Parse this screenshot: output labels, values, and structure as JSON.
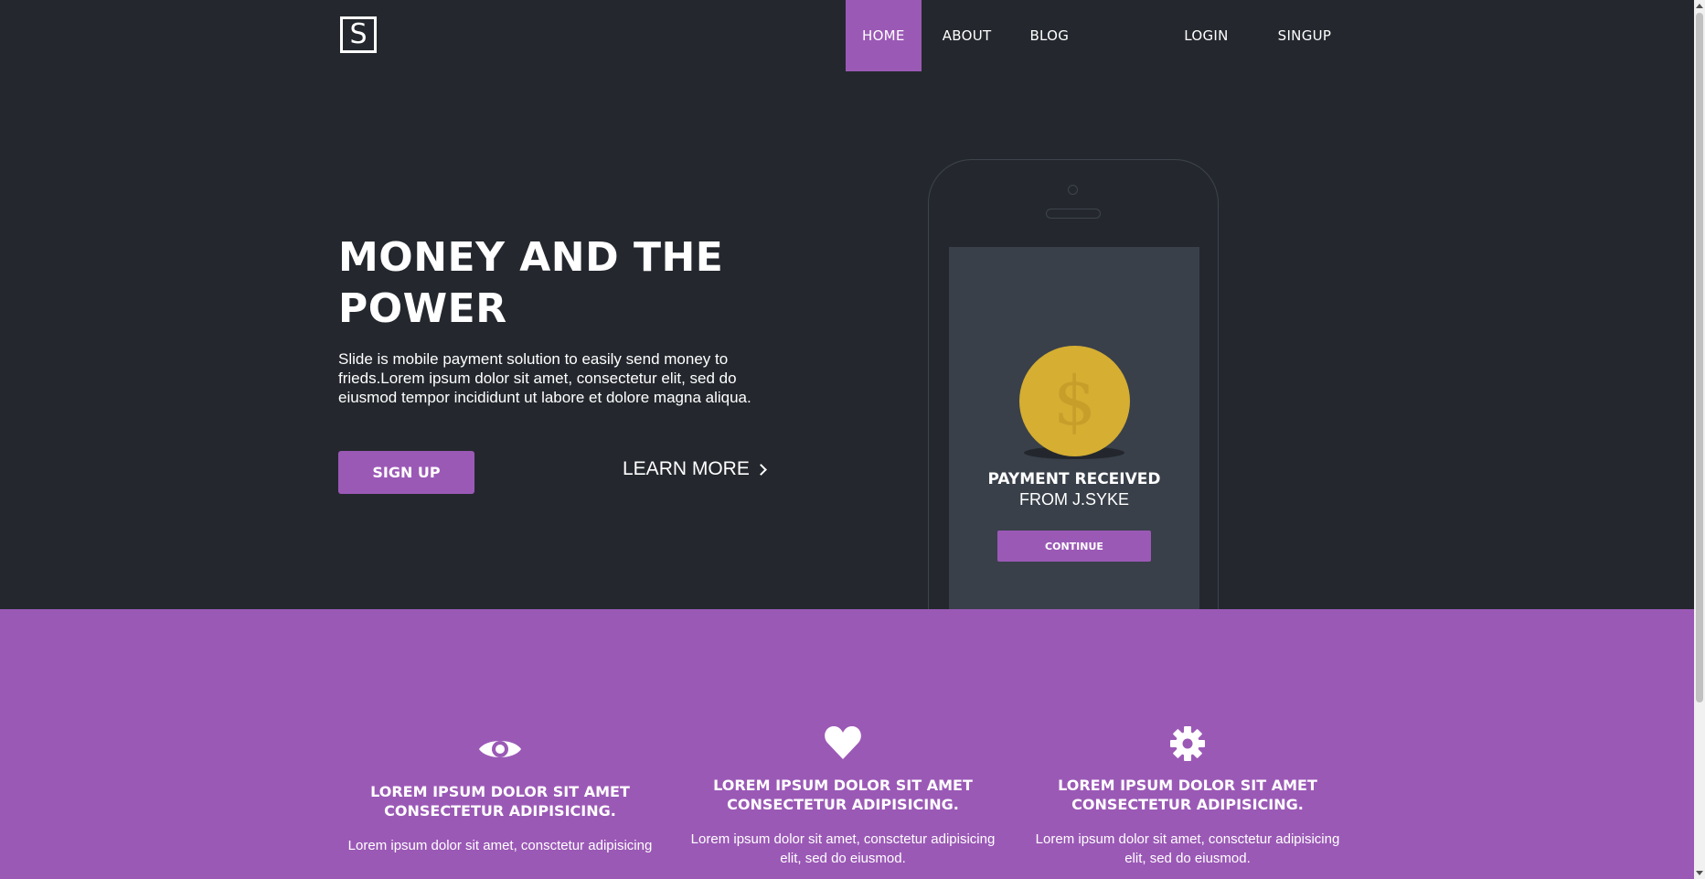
{
  "brand": {
    "logo_letter": "S"
  },
  "nav": {
    "home": "HOME",
    "about": "ABOUT",
    "blog": "BLOG",
    "login": "LOGIN",
    "signup": "SINGUP"
  },
  "hero": {
    "title_line1": "MONEY AND THE",
    "title_line2": "POWER",
    "description": "Slide is mobile payment solution to easily send money to frieds.Lorem ipsum dolor sit amet, consectetur elit, sed do eiusmod tempor incididunt ut labore et dolore magna aliqua.",
    "signup_button": "SIGN UP",
    "learn_more": "LEARN MORE"
  },
  "phone": {
    "coin_symbol": "$",
    "payment_title": "PAYMENT RECEIVED",
    "payment_from": "FROM J.SYKE",
    "continue_button": "CONTINUE"
  },
  "features": [
    {
      "icon": "eye-icon",
      "title": "LOREM IPSUM DOLOR SIT AMET CONSECTETUR ADIPISICING.",
      "text": "Lorem ipsum dolor sit amet, consctetur adipisicing"
    },
    {
      "icon": "heart-icon",
      "title": "LOREM IPSUM DOLOR SIT AMET CONSECTETUR ADIPISICING.",
      "text": "Lorem ipsum dolor sit amet, consctetur adipisicing elit, sed do eiusmod."
    },
    {
      "icon": "gear-icon",
      "title": "LOREM IPSUM DOLOR SIT AMET CONSECTETUR ADIPISICING.",
      "text": "Lorem ipsum dolor sit amet, consctetur adipisicing elit, sed do eiusmod."
    }
  ],
  "colors": {
    "background": "#24282e",
    "accent": "#9b59b6",
    "phone_screen": "#39404a",
    "coin": "#d5ae32"
  }
}
